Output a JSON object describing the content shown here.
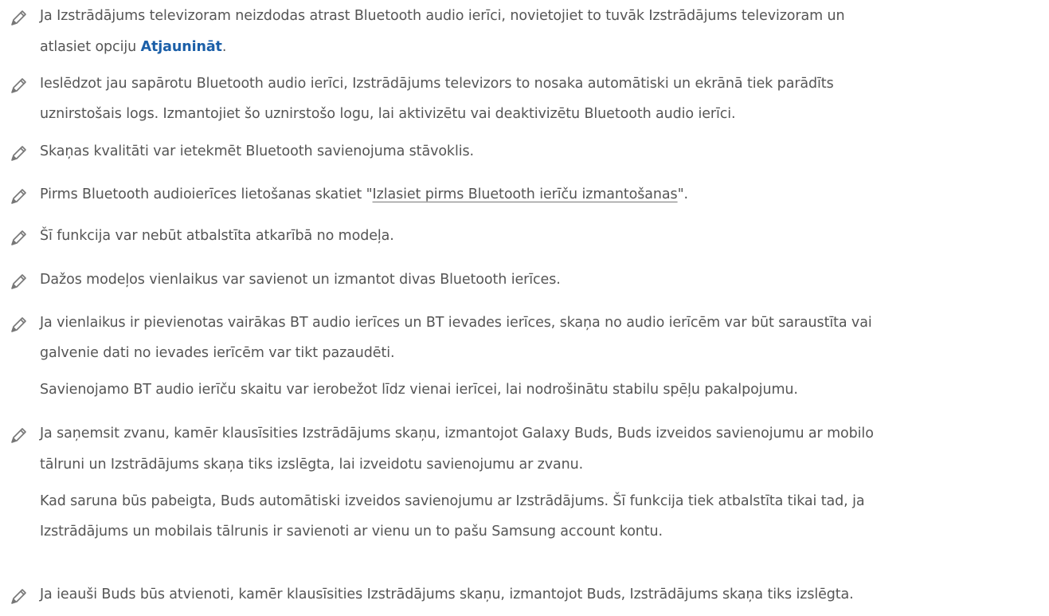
{
  "notes": [
    {
      "icon": "pencil-icon",
      "line1": "Ja Izstrādājums televizoram neizdodas atrast Bluetooth audio ierīci, novietojiet to tuvāk Izstrādājums televizoram un",
      "line2_pre": "atlasiet opciju ",
      "line2_link": "Atjaunināt",
      "line2_post": "."
    },
    {
      "icon": "pencil-icon",
      "line1": "Ieslēdzot jau sapārotu Bluetooth audio ierīci, Izstrādājums televizors to nosaka automātiski un ekrānā tiek parādīts",
      "line2": "uznirstošais logs. Izmantojiet šo uznirstošo logu, lai aktivizētu vai deaktivizētu Bluetooth audio ierīci."
    },
    {
      "icon": "pencil-icon",
      "line1": "Skaņas kvalitāti var ietekmēt Bluetooth savienojuma stāvoklis."
    },
    {
      "icon": "pencil-icon",
      "line1_pre": "Pirms Bluetooth audioierīces lietošanas skatiet \"",
      "line1_link": "Izlasiet pirms Bluetooth ierīču izmantošanas",
      "line1_post": "\"."
    },
    {
      "icon": "pencil-icon",
      "line1": "Šī funkcija var nebūt atbalstīta atkarībā no modeļa."
    },
    {
      "icon": "pencil-icon",
      "line1": "Dažos modeļos vienlaikus var savienot un izmantot divas Bluetooth ierīces."
    },
    {
      "icon": "pencil-icon",
      "line1": "Ja vienlaikus ir pievienotas vairākas BT audio ierīces un BT ievades ierīces, skaņa no audio ierīcēm var būt saraustīta vai",
      "line2": "galvenie dati no ievades ierīcēm var tikt pazaudēti.",
      "extra1": "Savienojamo BT audio ierīču skaitu var ierobežot līdz vienai ierīcei, lai nodrošinātu stabilu spēļu pakalpojumu."
    },
    {
      "icon": "pencil-icon",
      "line1": "Ja saņemsit zvanu, kamēr klausīsities Izstrādājums skaņu, izmantojot Galaxy Buds, Buds izveidos savienojumu ar mobilo",
      "line2": "tālruni un Izstrādājums skaņa tiks izslēgta, lai izveidotu savienojumu ar zvanu.",
      "extra1": "Kad saruna būs pabeigta, Buds automātiski izveidos savienojumu ar Izstrādājums. Šī funkcija tiek atbalstīta tikai tad, ja",
      "extra2": "Izstrādājums un mobilais tālrunis ir savienoti ar vienu un to pašu Samsung account kontu."
    },
    {
      "icon": "pencil-icon",
      "line1": "Ja ieauši Buds būs atvienoti, kamēr klausīsities Izstrādājums skaņu, izmantojot Buds, Izstrādājums skaņa tiks izslēgta."
    }
  ],
  "colors": {
    "text": "#555555",
    "link_blue": "#1b5fa8",
    "icon": "#777777"
  }
}
